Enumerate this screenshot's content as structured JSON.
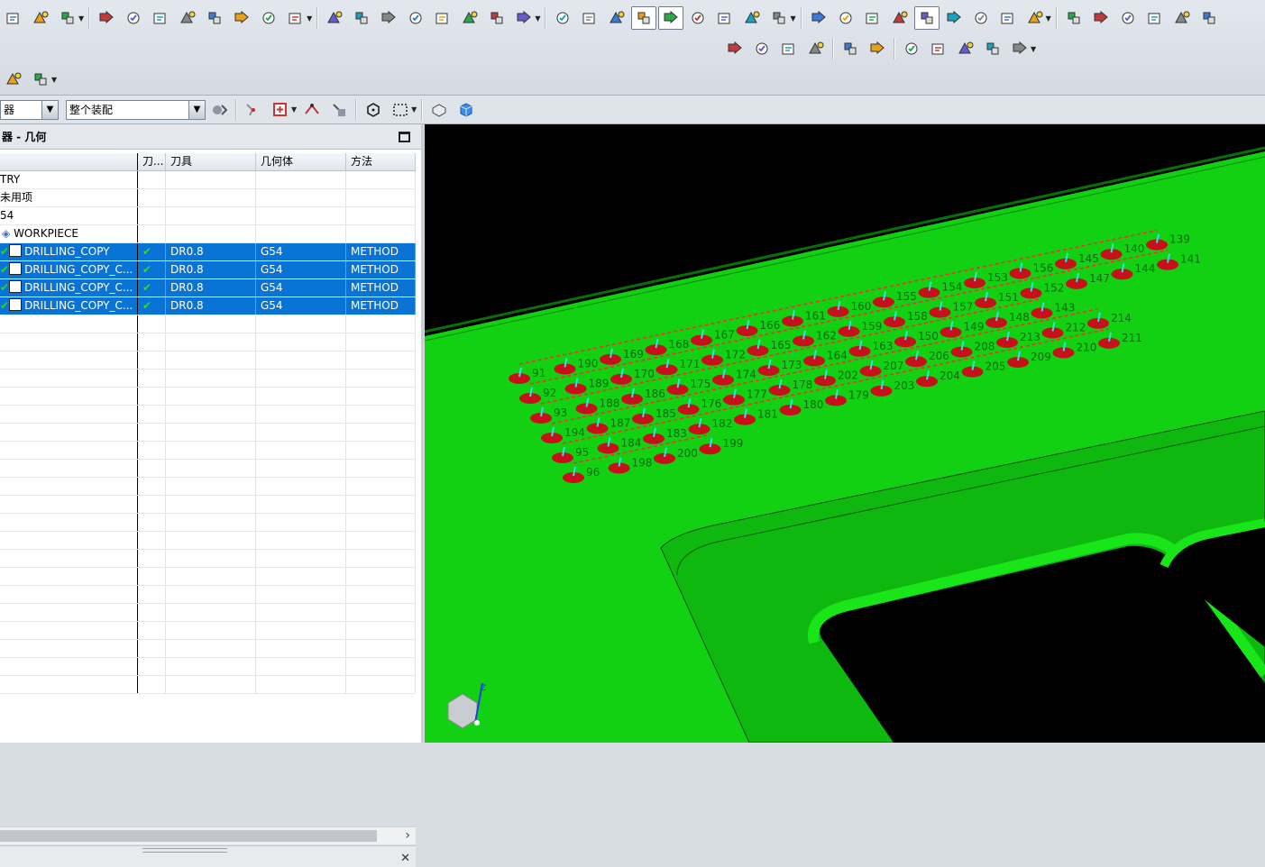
{
  "toolbar": {
    "row1_icons": [
      "workpiece-icon",
      "blank-icon",
      "program-order-icon",
      "create-program-icon",
      "create-tool-icon",
      "create-geometry-icon",
      "create-method-icon",
      "delete-icon",
      "properties-icon",
      "filter-icon",
      "machine-tool-view-icon",
      "tool-path-icon",
      "geometry-view-icon",
      "method-view-icon",
      "operation-navigator-icon",
      "stock-icon",
      "feed-rate-icon",
      "generate-icon",
      "replay-icon",
      "list-icon",
      "verify-icon",
      "display-tool-icon",
      "cutting-region-icon",
      "boundary-icon",
      "hole-icon",
      "curve-icon",
      "point-icon",
      "pattern-icon",
      "transform-icon",
      "postprocess-icon",
      "shop-docs-icon",
      "simulate-icon",
      "output-cls-icon",
      "tool-holder-icon",
      "isv-icon",
      "machine-control-icon",
      "feeds-speeds-icon",
      "optimize-icon",
      "edit-cut-region-icon",
      "add-point-icon",
      "probe-icon",
      "layer-icon",
      "extra-icon"
    ],
    "row2_icons": [
      "verify-check-icon",
      "tool-library-icon",
      "geometry-library-icon",
      "template-icon",
      "flag-icon",
      "zoom-region-icon",
      "report-icon",
      "list-tools-icon",
      "path-edit-icon",
      "clock-icon",
      "machine-settings-icon"
    ],
    "row1b_icons": [
      "assembly-navigator-icon",
      "part-navigator-icon"
    ]
  },
  "selection_bar": {
    "type_filter": "器",
    "scope_filter": "整个装配"
  },
  "navigator": {
    "title": "器 - 几何",
    "columns": [
      "",
      "刀...",
      "刀具",
      "几何体",
      "方法"
    ],
    "rows": [
      {
        "name": "TRY",
        "path": "",
        "tool": "",
        "geom": "",
        "method": "",
        "selected": false,
        "icon": ""
      },
      {
        "name": "未用项",
        "path": "",
        "tool": "",
        "geom": "",
        "method": "",
        "selected": false,
        "icon": ""
      },
      {
        "name": "54",
        "path": "",
        "tool": "",
        "geom": "",
        "method": "",
        "selected": false,
        "icon": ""
      },
      {
        "name": "WORKPIECE",
        "path": "",
        "tool": "",
        "geom": "",
        "method": "",
        "selected": false,
        "icon": "workpiece-icon"
      },
      {
        "name": "DRILLING_COPY",
        "path": "✔",
        "tool": "DR0.8",
        "geom": "G54",
        "method": "METHOD",
        "selected": true,
        "icon": "drill-op-icon"
      },
      {
        "name": "DRILLING_COPY_C...",
        "path": "✔",
        "tool": "DR0.8",
        "geom": "G54",
        "method": "METHOD",
        "selected": true,
        "icon": "drill-op-icon"
      },
      {
        "name": "DRILLING_COPY_C...",
        "path": "✔",
        "tool": "DR0.8",
        "geom": "G54",
        "method": "METHOD",
        "selected": true,
        "icon": "drill-op-icon"
      },
      {
        "name": "DRILLING_COPY_C...",
        "path": "✔",
        "tool": "DR0.8",
        "geom": "G54",
        "method": "METHOD",
        "selected": true,
        "icon": "drill-op-icon"
      }
    ],
    "empty_rows": 21
  },
  "viewport": {
    "background": "#000000",
    "part_color": "#1ed81e",
    "hole_color": "#c8101a",
    "hole_labels": [
      [
        "91",
        "190",
        "169",
        "168",
        "167",
        "166",
        "161",
        "160",
        "155",
        "154",
        "153",
        "156",
        "145",
        "140",
        "139"
      ],
      [
        "92",
        "189",
        "170",
        "171",
        "172",
        "165",
        "162",
        "159",
        "158",
        "157",
        "151",
        "152",
        "147",
        "144",
        "141"
      ],
      [
        "93",
        "188",
        "186",
        "175",
        "174",
        "173",
        "164",
        "163",
        "150",
        "149",
        "148",
        "143"
      ],
      [
        "194",
        "187",
        "185",
        "176",
        "177",
        "178",
        "202",
        "207",
        "206",
        "208",
        "213",
        "212",
        "214"
      ],
      [
        "95",
        "184",
        "183",
        "182",
        "181",
        "180",
        "179",
        "203",
        "204",
        "205",
        "209",
        "210",
        "211"
      ],
      [
        "96",
        "198",
        "200",
        "199"
      ]
    ]
  }
}
